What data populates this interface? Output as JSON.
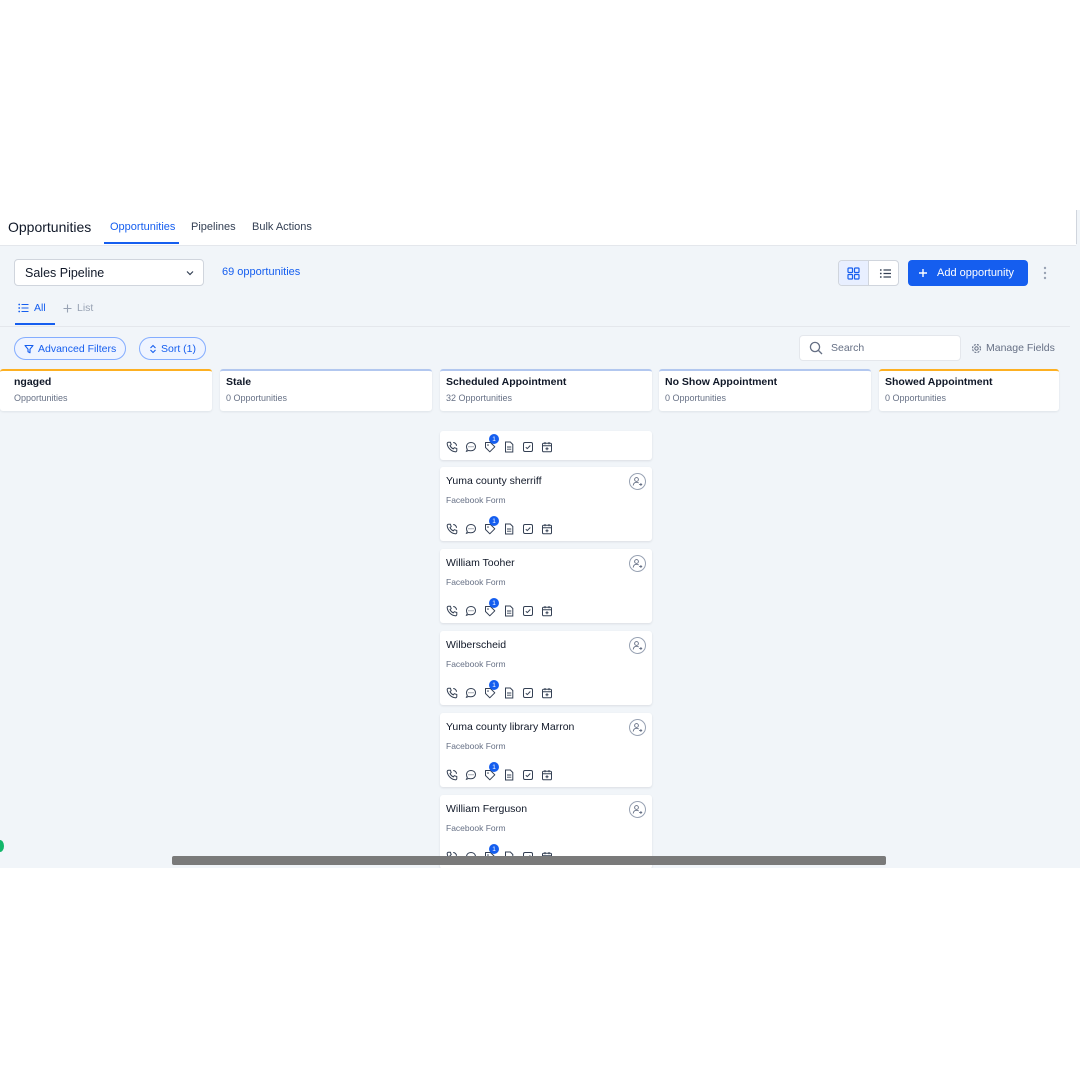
{
  "header": {
    "title": "Opportunities",
    "tabs": [
      {
        "label": "Opportunities",
        "active": true
      },
      {
        "label": "Pipelines",
        "active": false
      },
      {
        "label": "Bulk Actions",
        "active": false
      }
    ]
  },
  "toolbar": {
    "pipeline": "Sales Pipeline",
    "count": "69 opportunities",
    "add_label": "Add opportunity"
  },
  "subtabs": {
    "all": "All",
    "list": "List"
  },
  "filters": {
    "advanced": "Advanced Filters",
    "sort": "Sort (1)",
    "search_placeholder": "Search",
    "manage_fields": "Manage Fields"
  },
  "stages": [
    {
      "name": "ngaged",
      "count": "Opportunities"
    },
    {
      "name": "Stale",
      "count": "0 Opportunities"
    },
    {
      "name": "Scheduled Appointment",
      "count": "32 Opportunities"
    },
    {
      "name": "No Show Appointment",
      "count": "0 Opportunities"
    },
    {
      "name": "Showed Appointment",
      "count": "0 Opportunities"
    }
  ],
  "cards": [
    {
      "name": "Yuma county sherriff",
      "source": "Facebook Form",
      "badge": "1"
    },
    {
      "name": "William Tooher",
      "source": "Facebook Form",
      "badge": "1"
    },
    {
      "name": "Wilberscheid",
      "source": "Facebook Form",
      "badge": "1"
    },
    {
      "name": "Yuma county library Marron",
      "source": "Facebook Form",
      "badge": "1"
    },
    {
      "name": "William Ferguson",
      "source": "Facebook Form",
      "badge": "1"
    }
  ],
  "partial_card_badge": "1",
  "colors": {
    "accent": "#155eef",
    "background": "#f1f5f9",
    "stage_blue": "#b2c7ef",
    "stage_orange": "#fdb022"
  }
}
